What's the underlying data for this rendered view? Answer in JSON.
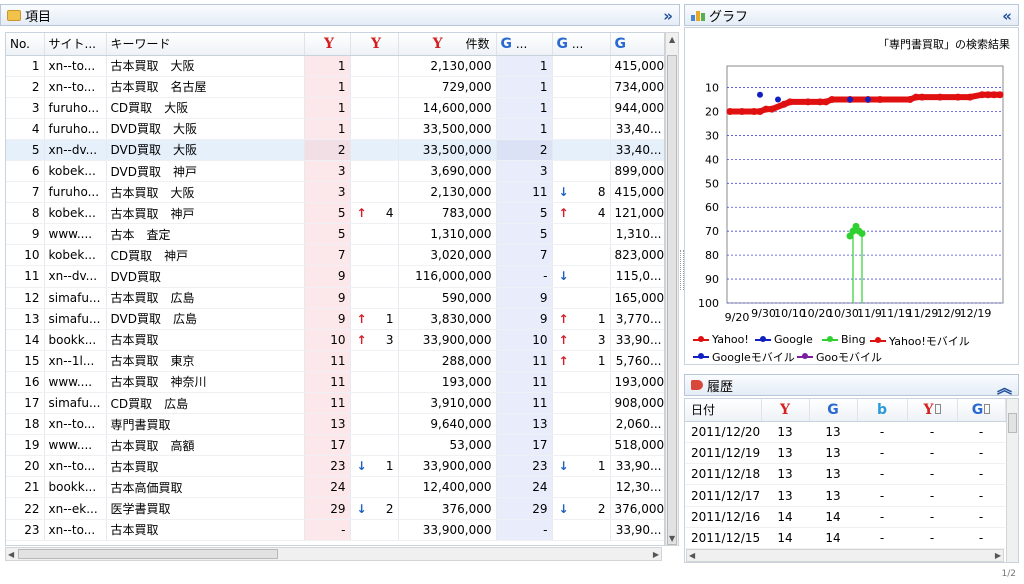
{
  "left_panel": {
    "title": "項目",
    "collapse_icon": "double-chevron-right"
  },
  "right_panel": {
    "title": "グラフ",
    "collapse_icon": "double-chevron-left"
  },
  "history_panel": {
    "title": "履歴",
    "collapse_icon": "double-chevron-up"
  },
  "columns": {
    "no": "No.",
    "site": "サイト...",
    "keyword": "キーワード",
    "yahoo_count": "件数",
    "google_dots": "...",
    "google_dots2": "..."
  },
  "rows": [
    {
      "no": "1",
      "site": "xn--to...",
      "kw": "古本買取　大阪",
      "yr": "1",
      "yd": "",
      "ydn": "",
      "yc": "2,130,000",
      "gr": "1",
      "gd": "",
      "gdn": "",
      "gc": "415,000"
    },
    {
      "no": "2",
      "site": "xn--to...",
      "kw": "古本買取　名古屋",
      "yr": "1",
      "yd": "",
      "ydn": "",
      "yc": "729,000",
      "gr": "1",
      "gd": "",
      "gdn": "",
      "gc": "734,000"
    },
    {
      "no": "3",
      "site": "furuho...",
      "kw": "CD買取　大阪",
      "yr": "1",
      "yd": "",
      "ydn": "",
      "yc": "14,600,000",
      "gr": "1",
      "gd": "",
      "gdn": "",
      "gc": "944,000"
    },
    {
      "no": "4",
      "site": "furuho...",
      "kw": "DVD買取　大阪",
      "yr": "1",
      "yd": "",
      "ydn": "",
      "yc": "33,500,000",
      "gr": "1",
      "gd": "",
      "gdn": "",
      "gc": "33,40..."
    },
    {
      "no": "5",
      "site": "xn--dv...",
      "kw": "DVD買取　大阪",
      "yr": "2",
      "yd": "",
      "ydn": "",
      "yc": "33,500,000",
      "gr": "2",
      "gd": "",
      "gdn": "",
      "gc": "33,40..."
    },
    {
      "no": "6",
      "site": "kobek...",
      "kw": "DVD買取　神戸",
      "yr": "3",
      "yd": "",
      "ydn": "",
      "yc": "3,690,000",
      "gr": "3",
      "gd": "",
      "gdn": "",
      "gc": "899,000"
    },
    {
      "no": "7",
      "site": "furuho...",
      "kw": "古本買取　大阪",
      "yr": "3",
      "yd": "",
      "ydn": "",
      "yc": "2,130,000",
      "gr": "11",
      "gd": "down",
      "gdn": "8",
      "gc": "415,000"
    },
    {
      "no": "8",
      "site": "kobek...",
      "kw": "古本買取　神戸",
      "yr": "5",
      "yd": "up",
      "ydn": "4",
      "yc": "783,000",
      "gr": "5",
      "gd": "up",
      "gdn": "4",
      "gc": "121,000"
    },
    {
      "no": "9",
      "site": "www....",
      "kw": "古本　査定",
      "yr": "5",
      "yd": "",
      "ydn": "",
      "yc": "1,310,000",
      "gr": "5",
      "gd": "",
      "gdn": "",
      "gc": "1,310..."
    },
    {
      "no": "10",
      "site": "kobek...",
      "kw": "CD買取　神戸",
      "yr": "7",
      "yd": "",
      "ydn": "",
      "yc": "3,020,000",
      "gr": "7",
      "gd": "",
      "gdn": "",
      "gc": "823,000"
    },
    {
      "no": "11",
      "site": "xn--dv...",
      "kw": "DVD買取",
      "yr": "9",
      "yd": "",
      "ydn": "",
      "yc": "116,000,000",
      "gr": "-",
      "gd": "down",
      "gdn": "",
      "gc": "115,0..."
    },
    {
      "no": "12",
      "site": "simafu...",
      "kw": "古本買取　広島",
      "yr": "9",
      "yd": "",
      "ydn": "",
      "yc": "590,000",
      "gr": "9",
      "gd": "",
      "gdn": "",
      "gc": "165,000"
    },
    {
      "no": "13",
      "site": "simafu...",
      "kw": "DVD買取　広島",
      "yr": "9",
      "yd": "up",
      "ydn": "1",
      "yc": "3,830,000",
      "gr": "9",
      "gd": "up",
      "gdn": "1",
      "gc": "3,770..."
    },
    {
      "no": "14",
      "site": "bookk...",
      "kw": "古本買取",
      "yr": "10",
      "yd": "up",
      "ydn": "3",
      "yc": "33,900,000",
      "gr": "10",
      "gd": "up",
      "gdn": "3",
      "gc": "33,90..."
    },
    {
      "no": "15",
      "site": "xn--1l...",
      "kw": "古本買取　東京",
      "yr": "11",
      "yd": "",
      "ydn": "",
      "yc": "288,000",
      "gr": "11",
      "gd": "up",
      "gdn": "1",
      "gc": "5,760..."
    },
    {
      "no": "16",
      "site": "www....",
      "kw": "古本買取　神奈川",
      "yr": "11",
      "yd": "",
      "ydn": "",
      "yc": "193,000",
      "gr": "11",
      "gd": "",
      "gdn": "",
      "gc": "193,000"
    },
    {
      "no": "17",
      "site": "simafu...",
      "kw": "CD買取　広島",
      "yr": "11",
      "yd": "",
      "ydn": "",
      "yc": "3,910,000",
      "gr": "11",
      "gd": "",
      "gdn": "",
      "gc": "908,000"
    },
    {
      "no": "18",
      "site": "xn--to...",
      "kw": "専門書買取",
      "yr": "13",
      "yd": "",
      "ydn": "",
      "yc": "9,640,000",
      "gr": "13",
      "gd": "",
      "gdn": "",
      "gc": "2,060..."
    },
    {
      "no": "19",
      "site": "www....",
      "kw": "古本買取　高額",
      "yr": "17",
      "yd": "",
      "ydn": "",
      "yc": "53,000",
      "gr": "17",
      "gd": "",
      "gdn": "",
      "gc": "518,000"
    },
    {
      "no": "20",
      "site": "xn--to...",
      "kw": "古本買取",
      "yr": "23",
      "yd": "down",
      "ydn": "1",
      "yc": "33,900,000",
      "gr": "23",
      "gd": "down",
      "gdn": "1",
      "gc": "33,90..."
    },
    {
      "no": "21",
      "site": "bookk...",
      "kw": "古本高価買取",
      "yr": "24",
      "yd": "",
      "ydn": "",
      "yc": "12,400,000",
      "gr": "24",
      "gd": "",
      "gdn": "",
      "gc": "12,30..."
    },
    {
      "no": "22",
      "site": "xn--ek...",
      "kw": "医学書買取",
      "yr": "29",
      "yd": "down",
      "ydn": "2",
      "yc": "376,000",
      "gr": "29",
      "gd": "down",
      "gdn": "2",
      "gc": "376,000"
    },
    {
      "no": "23",
      "site": "xn--to...",
      "kw": "古本買取",
      "yr": "-",
      "yd": "",
      "ydn": "",
      "yc": "33,900,000",
      "gr": "-",
      "gd": "",
      "gdn": "",
      "gc": "33,90..."
    }
  ],
  "selected_row": 4,
  "chart_data": {
    "type": "line",
    "title": "「専門書買取」の検索結果",
    "x": [
      "9/20",
      "9/30",
      "10/10",
      "10/20",
      "10/30",
      "11/9",
      "11/19",
      "11/29",
      "12/9",
      "12/19"
    ],
    "ylim": [
      100,
      1
    ],
    "yticks": [
      10,
      20,
      30,
      40,
      50,
      60,
      70,
      80,
      90,
      100
    ],
    "y_reversed": true,
    "grid": true,
    "legend_position": "bottom",
    "colors": {
      "Yahoo!": "#e01010",
      "Google": "#1020c0",
      "Bing": "#30d030",
      "Yahoo!モバイル": "#e01010",
      "Googleモバイル": "#1020c0",
      "Gooモバイル": "#7a1fa2"
    },
    "series": [
      {
        "name": "Yahoo!",
        "x": [
          0,
          4,
          8,
          10,
          12,
          14,
          18,
          20,
          26,
          30,
          32,
          34,
          40,
          46,
          50,
          60,
          62,
          64,
          70,
          76,
          80,
          84,
          86,
          88,
          90
        ],
        "values": [
          20,
          20,
          20,
          20,
          19,
          19,
          17,
          16,
          16,
          16,
          16,
          15,
          15,
          15,
          15,
          15,
          14,
          14,
          14,
          14,
          14,
          13,
          13,
          13,
          13
        ]
      },
      {
        "name": "Google",
        "x": [
          10,
          16,
          40,
          46
        ],
        "values": [
          13,
          15,
          15,
          15
        ]
      },
      {
        "name": "Bing",
        "x": [
          40,
          41,
          42,
          43,
          44
        ],
        "values": [
          72,
          70,
          68,
          70,
          71
        ]
      },
      {
        "name": "Yahoo!モバイル",
        "x": [],
        "values": []
      },
      {
        "name": "Googleモバイル",
        "x": [],
        "values": []
      },
      {
        "name": "Gooモバイル",
        "x": [],
        "values": []
      }
    ]
  },
  "history": {
    "columns": [
      "日付",
      "Y",
      "G",
      "b",
      "Y",
      "G"
    ],
    "rows": [
      [
        "2011/12/20",
        "13",
        "13",
        "-",
        "-",
        "-"
      ],
      [
        "2011/12/19",
        "13",
        "13",
        "-",
        "-",
        "-"
      ],
      [
        "2011/12/18",
        "13",
        "13",
        "-",
        "-",
        "-"
      ],
      [
        "2011/12/17",
        "13",
        "13",
        "-",
        "-",
        "-"
      ],
      [
        "2011/12/16",
        "14",
        "14",
        "-",
        "-",
        "-"
      ],
      [
        "2011/12/15",
        "14",
        "14",
        "-",
        "-",
        "-"
      ]
    ]
  },
  "status": "1/2"
}
